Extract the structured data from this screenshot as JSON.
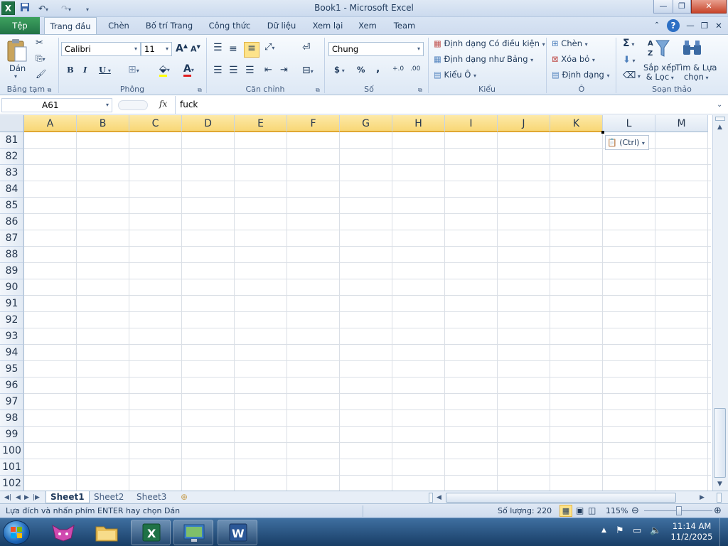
{
  "window": {
    "title": "Book1  -  Microsoft Excel",
    "app_icon": "X"
  },
  "tabs": {
    "file": "Tệp",
    "home": "Trang đầu",
    "insert": "Chèn",
    "layout": "Bố trí Trang",
    "formulas": "Công thức",
    "data": "Dữ liệu",
    "review": "Xem lại",
    "view": "Xem",
    "team": "Team"
  },
  "ribbon": {
    "clipboard": {
      "paste": "Dán",
      "label": "Bảng tạm"
    },
    "font": {
      "name": "Calibri",
      "size": "11",
      "label": "Phông",
      "bold": "B",
      "italic": "I",
      "underline": "U",
      "grow": "A",
      "shrink": "A",
      "color_letter": "A"
    },
    "alignment": {
      "label": "Căn chỉnh"
    },
    "number": {
      "format": "Chung",
      "label": "Số",
      "currency": "$",
      "percent": "%",
      "comma": ",",
      "inc_decimal": "+.0",
      "dec_decimal": ".00"
    },
    "styles": {
      "conditional": "Định dạng Có điều kiện",
      "as_table": "Định dạng như Bảng",
      "cell_styles": "Kiểu Ô",
      "label": "Kiểu"
    },
    "cells": {
      "insert": "Chèn",
      "delete": "Xóa bỏ",
      "format": "Định dạng",
      "label": "Ô"
    },
    "editing": {
      "sort1": "Sắp xếp",
      "sort2": "& Lọc",
      "find1": "Tìm & Lựa",
      "find2": "chọn",
      "label": "Soạn thảo",
      "sum": "Σ"
    }
  },
  "formula_bar": {
    "name_box": "A61",
    "fx": "fx",
    "content": "fuck"
  },
  "columns": [
    "A",
    "B",
    "C",
    "D",
    "E",
    "F",
    "G",
    "H",
    "I",
    "J",
    "K",
    "L",
    "M"
  ],
  "rows": [
    "81",
    "82",
    "83",
    "84",
    "85",
    "86",
    "87",
    "88",
    "89",
    "90",
    "91",
    "92",
    "93",
    "94",
    "95",
    "96",
    "97",
    "98",
    "99",
    "100",
    "101",
    "102"
  ],
  "paste_options": {
    "label": "(Ctrl)"
  },
  "sheets": [
    "Sheet1",
    "Sheet2",
    "Sheet3"
  ],
  "status": {
    "message": "Lựa đích và nhấn phím ENTER hay chọn Dán",
    "count": "Số lượng: 220",
    "zoom": "115%"
  },
  "taskbar": {
    "time": "11:14 AM",
    "date": "11/2/2025"
  }
}
